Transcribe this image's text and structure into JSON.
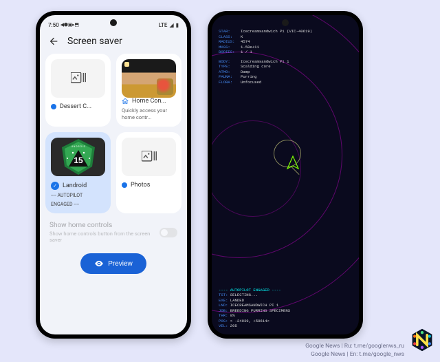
{
  "status": {
    "time": "7:50",
    "icons_left": "◀ ⬢ ▣ ▸ ⬒",
    "lte": "LTE",
    "signal": "◢",
    "battery": "▮"
  },
  "header": {
    "title": "Screen saver"
  },
  "cards": {
    "dessert": {
      "label": "Dessert C..."
    },
    "home": {
      "label": "Home Con...",
      "desc": "Quickly access your home contr..."
    },
    "landroid": {
      "label": "Landroid",
      "sub1": "---- AUTOPILOT",
      "sub2": "ENGAGED ----",
      "badge_top": "A N D R O I D",
      "badge_num": "15"
    },
    "photos": {
      "label": "Photos"
    }
  },
  "settings": {
    "title": "Show home controls",
    "desc": "Show home controls button from the screen saver"
  },
  "preview": {
    "label": "Preview"
  },
  "terminal": {
    "star_l": "STAR:",
    "star": "Icecreamsandwich Pi (VIC-40619)",
    "class_l": "CLASS:",
    "class": "K",
    "radius_l": "RADIUS:",
    "radius": "4574",
    "mass_l": "MASS:",
    "mass": "1.50e+11",
    "bodies_l": "BODIES:",
    "bodies": "1 / 1",
    "body_l": "BODY:",
    "body": "Icecreamsandwich Pi 1",
    "type_l": "TYPE:",
    "type": "Scalding core",
    "atmo_l": "ATMO:",
    "atmo": "Damp",
    "fauna_l": "FAUNA:",
    "fauna": "Purring",
    "flora_l": "FLORA:",
    "flora": "Unfocused",
    "auto": "---- AUTOPILOT ENGAGED ----",
    "tgt_l": "TGT:",
    "tgt": "SELECTING...",
    "exe_l": "EXE:",
    "exe": "LANDED",
    "lnd_l": "LND:",
    "lnd": "ICECREAMSANDWICH PI 1",
    "job_l": "JOB:",
    "job": "BREEDING PURRING SPECIMENS",
    "thr_l": "THR:",
    "thr": "0%",
    "pos_l": "POS:",
    "pos": "< -24939, +50614>",
    "vel_l": "VEL:",
    "vel": "205"
  },
  "footer": {
    "line1": "Google News | Ru: t.me/googlenws_ru",
    "line2": "Google News | En: t.me/google_nws"
  }
}
